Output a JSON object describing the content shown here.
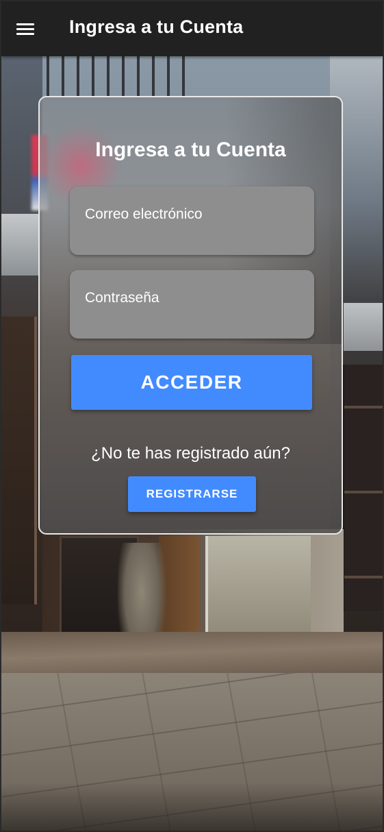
{
  "app_bar": {
    "title": "Ingresa a tu Cuenta",
    "menu_icon": "hamburger-menu-icon",
    "background": "#212121"
  },
  "login_card": {
    "title": "Ingresa a tu Cuenta",
    "email_field": {
      "placeholder": "Correo electrónico",
      "value": ""
    },
    "password_field": {
      "placeholder": "Contraseña",
      "value": ""
    },
    "access_button_label": "ACCEDER",
    "register_prompt": "¿No te has registrado aún?",
    "register_button_label": "REGISTRARSE"
  },
  "colors": {
    "accent": "#428bff",
    "field_background": "#8e8e8e",
    "text": "#ffffff"
  }
}
